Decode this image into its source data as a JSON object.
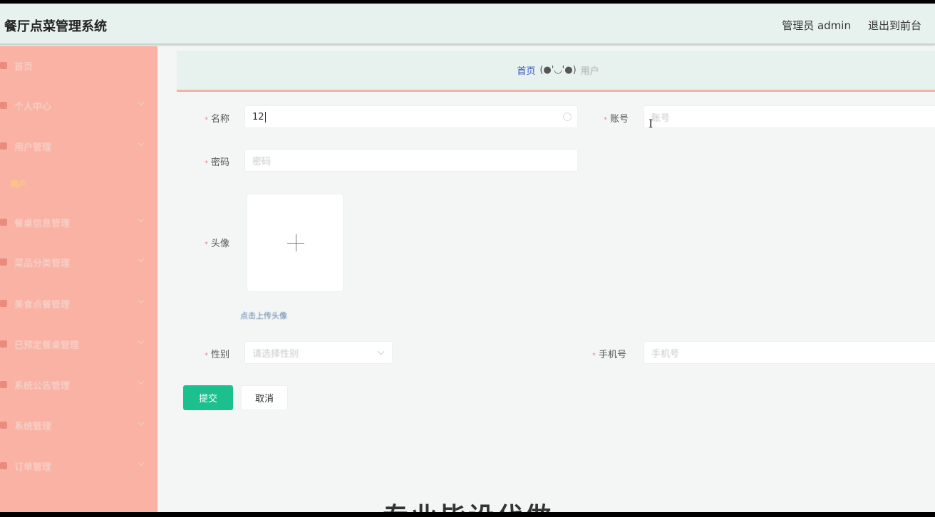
{
  "app": {
    "title": "餐厅点菜管理系统"
  },
  "header": {
    "user": "管理员 admin",
    "front": "退出到前台",
    "logout": "退"
  },
  "sidebar": {
    "items": [
      {
        "label": "首页",
        "icon": "home-icon",
        "chevron": false
      },
      {
        "label": "个人中心",
        "icon": "person-icon",
        "chevron": true
      },
      {
        "label": "用户管理",
        "icon": "user-icon",
        "chevron": true
      },
      {
        "label": "餐桌信息管理",
        "icon": "table-icon",
        "chevron": true
      },
      {
        "label": "菜品分类管理",
        "icon": "list-icon",
        "chevron": true
      },
      {
        "label": "美食点餐管理",
        "icon": "food-icon",
        "chevron": true
      },
      {
        "label": "已预定餐桌管理",
        "icon": "calendar-icon",
        "chevron": true
      },
      {
        "label": "系统公告管理",
        "icon": "notice-icon",
        "chevron": true
      },
      {
        "label": "系统管理",
        "icon": "settings-icon",
        "chevron": true
      },
      {
        "label": "订单管理",
        "icon": "order-icon",
        "chevron": true
      }
    ],
    "active_sub": "用户"
  },
  "breadcrumb": {
    "home": "首页",
    "sep": "(●'◡'●)",
    "current": "用户"
  },
  "form": {
    "name": {
      "label": "名称",
      "value": "12"
    },
    "account": {
      "label": "账号",
      "placeholder": "账号"
    },
    "password": {
      "label": "密码",
      "placeholder": "密码"
    },
    "avatar": {
      "label": "头像",
      "tip": "点击上传头像"
    },
    "gender": {
      "label": "性别",
      "placeholder": "请选择性别"
    },
    "phone": {
      "label": "手机号",
      "placeholder": "手机号"
    },
    "submit": "提交",
    "cancel": "取消"
  },
  "watermark": "专业毕设代做",
  "colors": {
    "sidebar": "#f9b2a4",
    "accent": "#1cc08e",
    "header": "#e7f1ee"
  }
}
